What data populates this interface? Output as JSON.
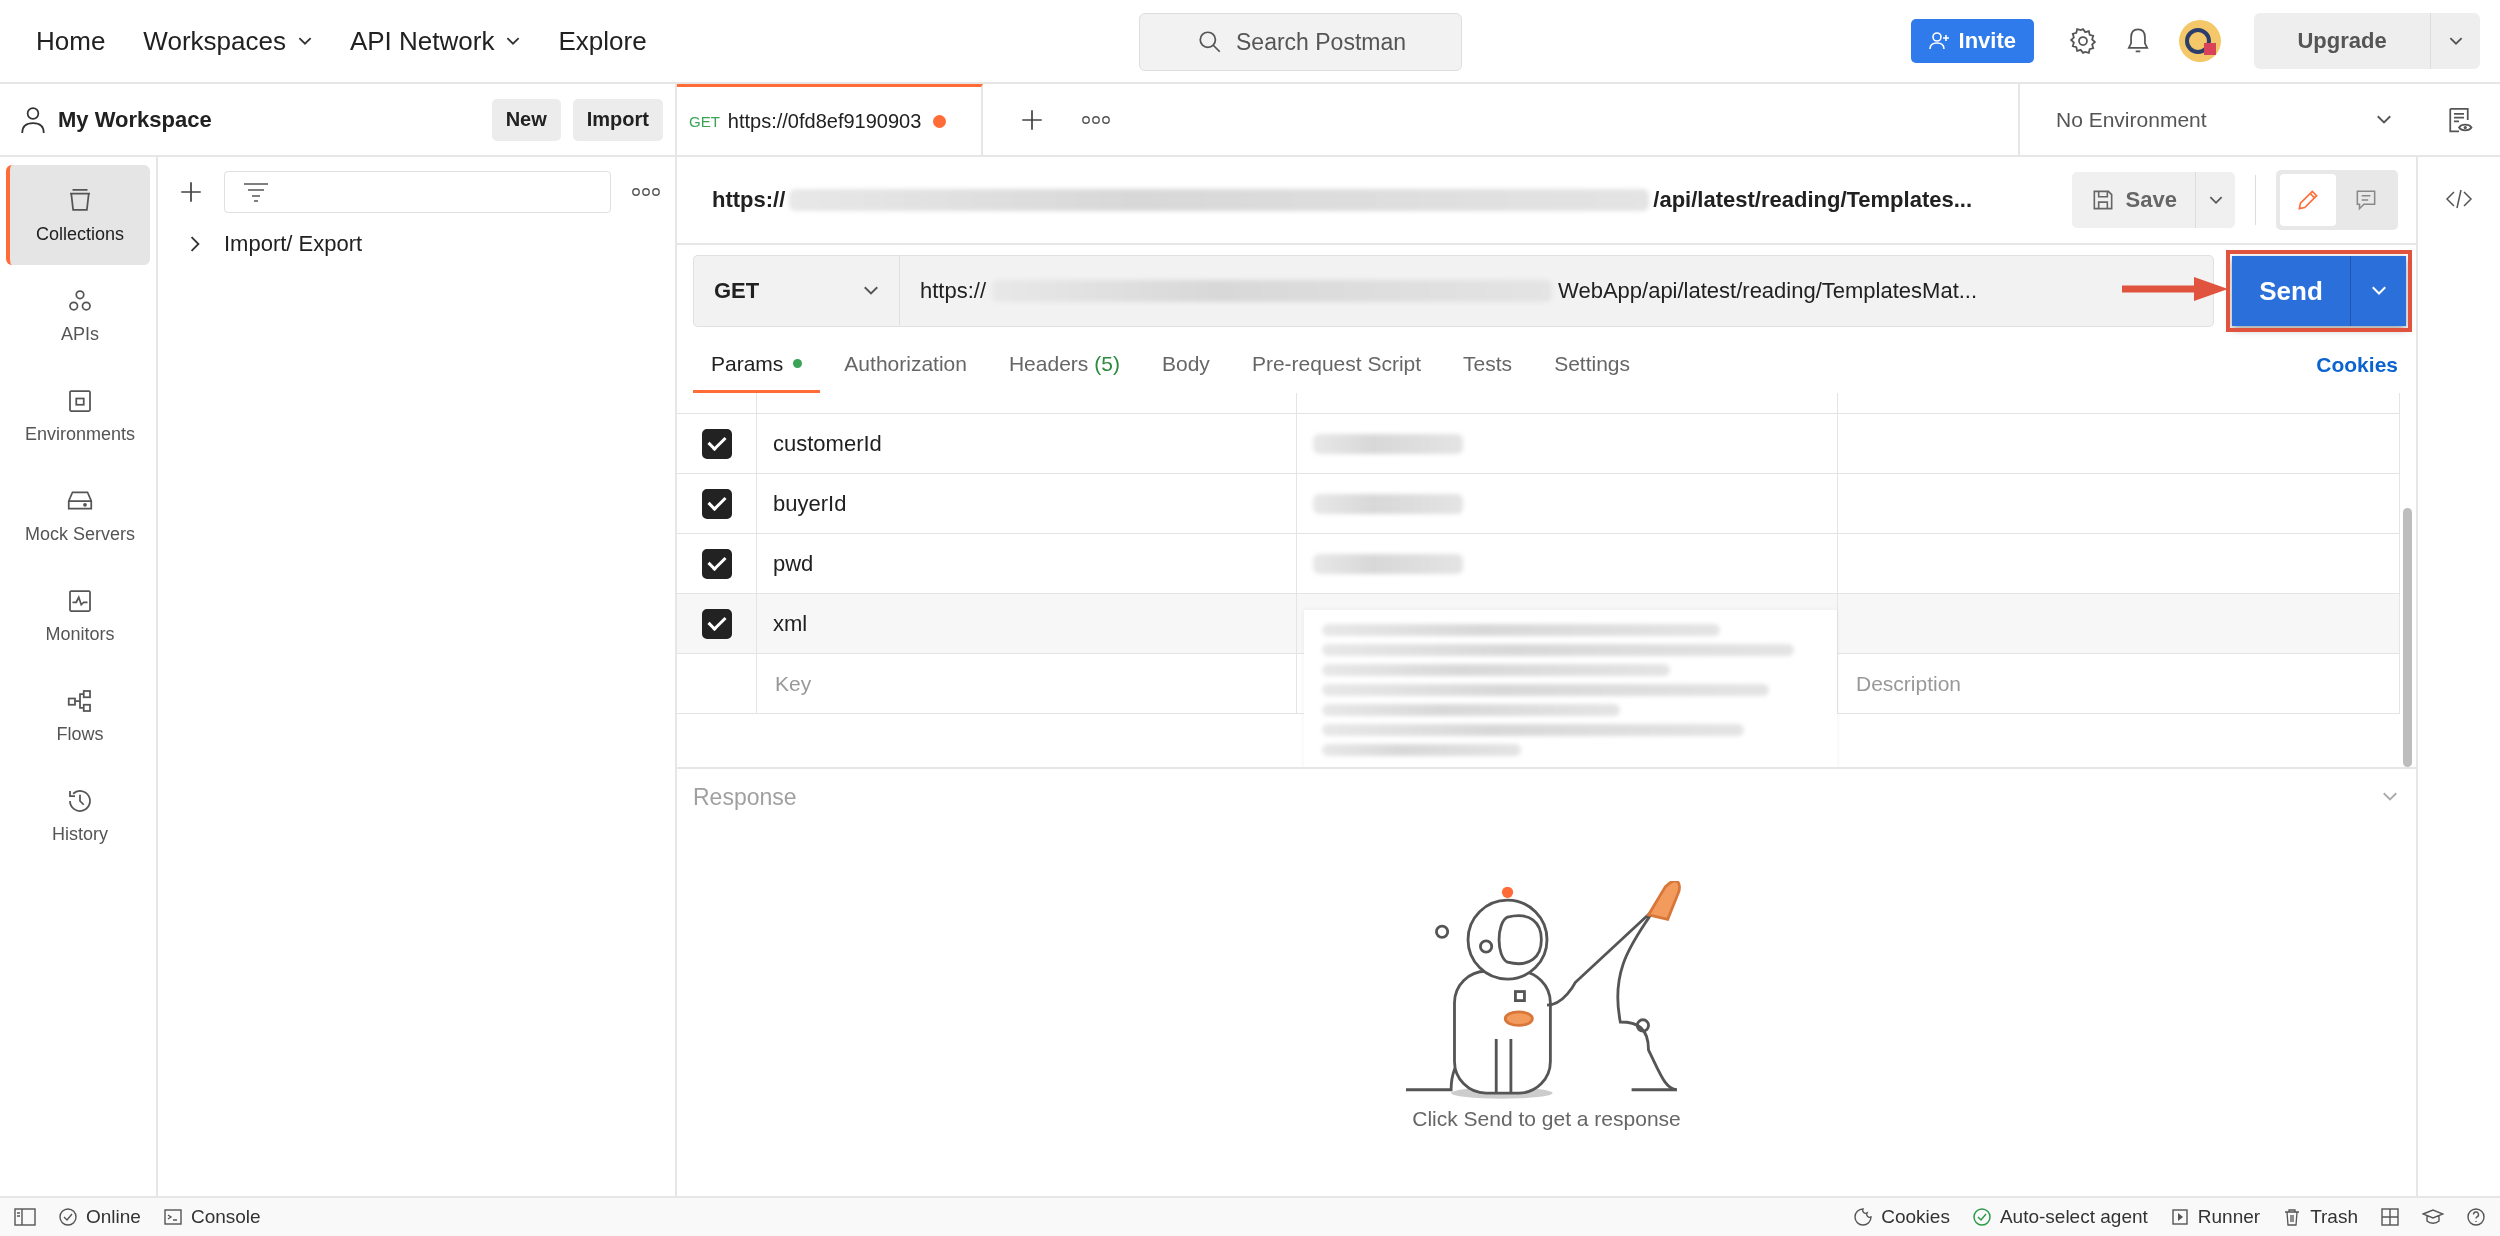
{
  "top_nav": [
    {
      "label": "Home",
      "has_menu": false
    },
    {
      "label": "Workspaces",
      "has_menu": true
    },
    {
      "label": "API Network",
      "has_menu": true
    },
    {
      "label": "Explore",
      "has_menu": false
    }
  ],
  "search": {
    "placeholder": "Search Postman"
  },
  "invite_button": "Invite",
  "upgrade_button": "Upgrade",
  "workspace": {
    "title": "My Workspace",
    "buttons": [
      "New",
      "Import"
    ]
  },
  "sidebar": {
    "items": [
      {
        "label": "Collections",
        "selected": true
      },
      {
        "label": "APIs",
        "selected": false
      },
      {
        "label": "Environments",
        "selected": false
      },
      {
        "label": "Mock Servers",
        "selected": false
      },
      {
        "label": "Monitors",
        "selected": false
      },
      {
        "label": "Flows",
        "selected": false
      },
      {
        "label": "History",
        "selected": false
      }
    ]
  },
  "tree": [
    {
      "label": "Import/ Export",
      "expanded": false
    }
  ],
  "request_tab": {
    "method": "GET",
    "title": "https://0fd8ef9190903",
    "unsaved": true
  },
  "environment": "No Environment",
  "request": {
    "title_prefix": "https://",
    "title_suffix": "/api/latest/reading/Templates...",
    "save_button": "Save",
    "method": "GET",
    "url_prefix": "https://",
    "url_suffix": "WebApp/api/latest/reading/TemplatesMat...",
    "send_button": "Send"
  },
  "mode_toggle": [
    {
      "selected": true
    },
    {
      "selected": false
    }
  ],
  "tabs": [
    {
      "label": "Params",
      "selected": true,
      "indicator": true
    },
    {
      "label": "Authorization",
      "selected": false,
      "indicator": false
    },
    {
      "label": "Headers",
      "count": "(5)",
      "selected": false,
      "indicator": false
    },
    {
      "label": "Body",
      "selected": false,
      "indicator": false
    },
    {
      "label": "Pre-request Script",
      "selected": false,
      "indicator": false
    },
    {
      "label": "Tests",
      "selected": false,
      "indicator": false
    },
    {
      "label": "Settings",
      "selected": false,
      "indicator": false
    }
  ],
  "cookies_link": "Cookies",
  "params": {
    "rows": [
      {
        "key": "customerId",
        "checked": true
      },
      {
        "key": "buyerId",
        "checked": true
      },
      {
        "key": "pwd",
        "checked": true
      },
      {
        "key": "xml",
        "checked": true
      }
    ],
    "key_placeholder": "Key",
    "description_placeholder": "Description"
  },
  "response": {
    "label": "Response",
    "empty_message": "Click Send to get a response"
  },
  "status_bar": {
    "left": [
      "Online",
      "Console"
    ],
    "right": [
      "Cookies",
      "Auto-select agent",
      "Runner",
      "Trash"
    ]
  }
}
